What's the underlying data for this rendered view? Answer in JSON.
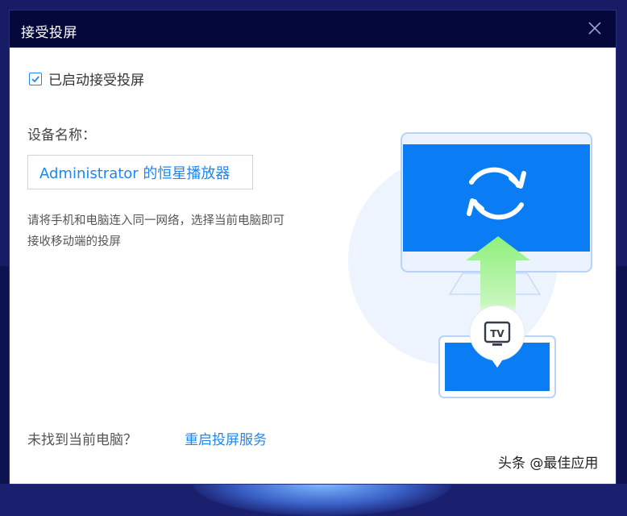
{
  "dialog": {
    "title": "接受投屏",
    "checkbox_label": "已启动接受投屏",
    "checkbox_checked": true,
    "device_name_label": "设备名称：",
    "device_name_value": "Administrator 的恒星播放器",
    "hint": "请将手机和电脑连入同一网络，选择当前电脑即可接收移动端的投屏",
    "footer_text": "未找到当前电脑？",
    "footer_link": "重启投屏服务",
    "tv_icon_label": "TV"
  },
  "watermark": "头条 @最佳应用",
  "colors": {
    "accent": "#1f86f0",
    "screen_blue": "#0a7df5",
    "titlebar": "#05083a",
    "arrow_green": "#8ef07c"
  },
  "icons": {
    "close": "close-icon",
    "check": "check-icon",
    "sync": "sync-icon",
    "tv": "tv-icon"
  }
}
